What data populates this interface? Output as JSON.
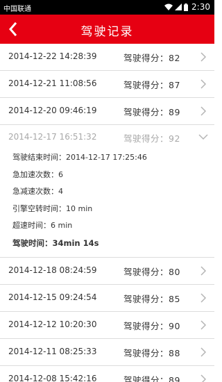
{
  "status_bar": {
    "carrier": "中国联通",
    "time": "2:30"
  },
  "header": {
    "title": "驾驶记录"
  },
  "records_before": [
    {
      "datetime": "2014-12-22  14:28:39",
      "score": "驾驶得分：82"
    },
    {
      "datetime": "2014-12-21  11:08:56",
      "score": "驾驶得分：87"
    },
    {
      "datetime": "2014-12-20  09:46:19",
      "score": "驾驶得分：89"
    }
  ],
  "expanded_record": {
    "datetime": "2014-12-17  16:51:32",
    "score": "驾驶得分：92",
    "details": {
      "end_time": "驾驶结束时间：2014-12-17  17:25:46",
      "rapid_accel": "急加速次数：6",
      "rapid_decel": "急减速次数：4",
      "idle": "引擎空转时间：10 min",
      "overspeed": "超速时间：6 min",
      "duration": "驾驶时间：34min 14s"
    }
  },
  "records_after": [
    {
      "datetime": "2014-12-18  08:24:59",
      "score": "驾驶得分：80"
    },
    {
      "datetime": "2014-12-15  09:24:54",
      "score": "驾驶得分：85"
    },
    {
      "datetime": "2014-12-12  10:20:30",
      "score": "驾驶得分：90"
    },
    {
      "datetime": "2014-12-11  08:25:33",
      "score": "驾驶得分：88"
    },
    {
      "datetime": "2014-12-08  15:42:16",
      "score": "驾驶得分：89"
    }
  ]
}
